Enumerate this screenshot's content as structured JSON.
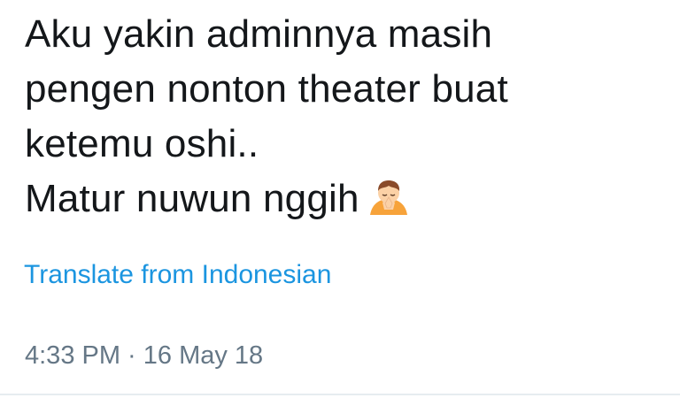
{
  "tweet": {
    "lines": [
      "Aku yakin adminnya masih",
      "pengen nonton theater buat",
      "ketemu oshi..",
      "Matur nuwun nggih"
    ],
    "emoji_icon": "person-bowing-emoji",
    "translate_label": "Translate from Indonesian",
    "timestamp": "4:33 PM · 16 May 18"
  },
  "colors": {
    "text": "#14171a",
    "link": "#1b95e0",
    "meta": "#657786",
    "divider": "#e6ecf0"
  }
}
